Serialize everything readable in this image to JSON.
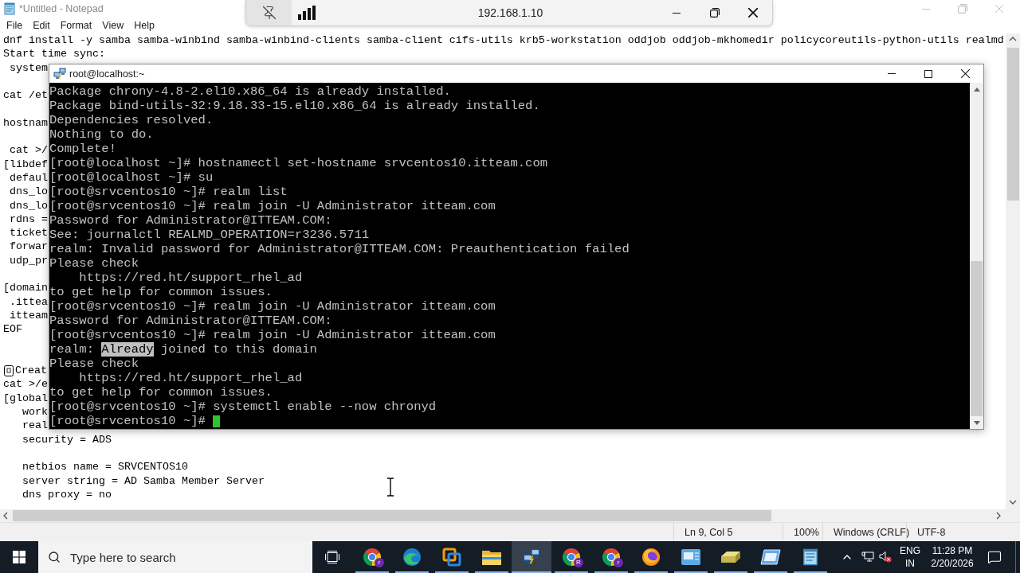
{
  "notepad": {
    "title": "*Untitled - Notepad",
    "menu": [
      "File",
      "Edit",
      "Format",
      "View",
      "Help"
    ],
    "lines": [
      {
        "kind": "text",
        "text": "dnf install -y samba samba-winbind samba-winbind-clients samba-client cifs-utils krb5-workstation oddjob oddjob-mkhomedir policycoreutils-python-utils realmd"
      },
      {
        "kind": "text",
        "text": "Start time sync:"
      },
      {
        "kind": "text",
        "text": " system"
      },
      {
        "kind": "blank"
      },
      {
        "kind": "text",
        "text": "cat /et"
      },
      {
        "kind": "blank"
      },
      {
        "kind": "text",
        "text": "hostnam"
      },
      {
        "kind": "blank"
      },
      {
        "kind": "text",
        "text": " cat >/"
      },
      {
        "kind": "text",
        "text": "[libdef"
      },
      {
        "kind": "text",
        "text": " defaul"
      },
      {
        "kind": "text",
        "text": " dns_lo"
      },
      {
        "kind": "text",
        "text": " dns_lo"
      },
      {
        "kind": "text",
        "text": " rdns ="
      },
      {
        "kind": "text",
        "text": " ticket"
      },
      {
        "kind": "text",
        "text": " forwar"
      },
      {
        "kind": "text",
        "text": " udp_pr"
      },
      {
        "kind": "blank"
      },
      {
        "kind": "text",
        "text": "[domain"
      },
      {
        "kind": "text",
        "text": " .ittea"
      },
      {
        "kind": "text",
        "text": " itteam"
      },
      {
        "kind": "text",
        "text": "EOF"
      },
      {
        "kind": "blank"
      },
      {
        "kind": "blank"
      },
      {
        "kind": "glyph",
        "text": "Creat"
      },
      {
        "kind": "text",
        "text": "cat >/e"
      },
      {
        "kind": "text",
        "text": "[global"
      },
      {
        "kind": "text",
        "text": "   work"
      },
      {
        "kind": "text",
        "text": "   real"
      },
      {
        "kind": "text",
        "text": "   security = ADS"
      },
      {
        "kind": "blank"
      },
      {
        "kind": "text",
        "text": "   netbios name = SRVCENTOS10"
      },
      {
        "kind": "text",
        "text": "   server string = AD Samba Member Server"
      },
      {
        "kind": "text",
        "text": "   dns proxy = no"
      }
    ],
    "status_bar": {
      "position": "Ln 9, Col 5",
      "zoom": "100%",
      "line_ending": "Windows (CRLF)",
      "encoding": "UTF-8"
    }
  },
  "remote_bar": {
    "address": "192.168.1.10"
  },
  "terminal": {
    "title": "root@localhost:~",
    "cursor": true,
    "lines": [
      {
        "text": "Package chrony-4.8-2.el10.x86_64 is already installed."
      },
      {
        "text": "Package bind-utils-32:9.18.33-15.el10.x86_64 is already installed."
      },
      {
        "text": "Dependencies resolved."
      },
      {
        "text": "Nothing to do."
      },
      {
        "text": "Complete!"
      },
      {
        "text": "[root@localhost ~]# hostnamectl set-hostname srvcentos10.itteam.com"
      },
      {
        "text": "[root@localhost ~]# su"
      },
      {
        "text": "[root@srvcentos10 ~]# realm list"
      },
      {
        "text": "[root@srvcentos10 ~]# realm join -U Administrator itteam.com"
      },
      {
        "text": "Password for Administrator@ITTEAM.COM:"
      },
      {
        "text": "See: journalctl REALMD_OPERATION=r3236.5711"
      },
      {
        "text": "realm: Invalid password for Administrator@ITTEAM.COM: Preauthentication failed"
      },
      {
        "text": "Please check"
      },
      {
        "text": "    https://red.ht/support_rhel_ad"
      },
      {
        "text": "to get help for common issues."
      },
      {
        "text": "[root@srvcentos10 ~]# realm join -U Administrator itteam.com"
      },
      {
        "text": "Password for Administrator@ITTEAM.COM:"
      },
      {
        "text": "[root@srvcentos10 ~]# realm join -U Administrator itteam.com"
      },
      {
        "segments": [
          {
            "text": "realm: ",
            "selected": false
          },
          {
            "text": "Already",
            "selected": true
          },
          {
            "text": " joined to this domain",
            "selected": false
          }
        ]
      },
      {
        "text": "Please check"
      },
      {
        "text": "    https://red.ht/support_rhel_ad"
      },
      {
        "text": "to get help for common issues."
      },
      {
        "text": "[root@srvcentos10 ~]# systemctl enable --now chronyd"
      },
      {
        "text": "[root@srvcentos10 ~]#"
      }
    ]
  },
  "taskbar": {
    "search_placeholder": "Type here to search",
    "apps": [
      {
        "kind": "ring_browser",
        "badge": "r",
        "running": true,
        "selected": false
      },
      {
        "kind": "wave_browser",
        "running": true,
        "selected": false
      },
      {
        "kind": "squares",
        "running": true,
        "selected": false
      },
      {
        "kind": "folder",
        "running": true,
        "selected": false
      },
      {
        "kind": "network",
        "running": true,
        "selected": true
      },
      {
        "kind": "ring_browser",
        "badge": "R",
        "running": true,
        "selected": false
      },
      {
        "kind": "ring_browser",
        "badge": "r",
        "running": true,
        "selected": false
      },
      {
        "kind": "globe_browser",
        "running": true,
        "selected": false
      },
      {
        "kind": "panel",
        "running": true,
        "selected": false
      },
      {
        "kind": "drive",
        "running": true,
        "selected": false
      },
      {
        "kind": "slanted_window",
        "running": true,
        "selected": false
      },
      {
        "kind": "notepad",
        "running": true,
        "selected": false
      }
    ],
    "tray": {
      "input_language": "ENG",
      "input_region": "IN",
      "time": "11:28 PM",
      "date": "2/20/2026"
    }
  }
}
